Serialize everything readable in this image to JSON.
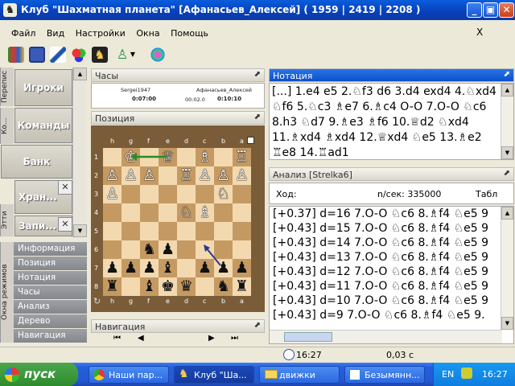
{
  "window": {
    "title": "Клуб \"Шахматная планета\" [Афанасьев_Алексей]  ( 1959 | 2419 | 2208 )"
  },
  "menu": [
    "Файл",
    "Вид",
    "Настройки",
    "Окна",
    "Помощь"
  ],
  "mdi_close": "X",
  "side": {
    "vtabs": [
      "Перепис",
      "Ко...",
      "Этти",
      "Окна режимов"
    ],
    "buttons": {
      "players": "Игроки",
      "teams": "Команды",
      "bank": "Банк",
      "storage": "Хран...",
      "records": "Запи..."
    },
    "nav_items": [
      "Информация",
      "Позиция",
      "Нотация",
      "Часы",
      "Анализ",
      "Дерево",
      "Навигация"
    ]
  },
  "panels": {
    "clocks": "Часы",
    "position": "Позиция",
    "notation": "Нотация",
    "analysis": "Анализ [Strelka6]",
    "navigation": "Навигация"
  },
  "clocks": {
    "white_name": "Sergei1947",
    "black_name": "Афанасьев_Алексей",
    "white_time": "0:07:00",
    "small_time": "00:02.0",
    "black_time": "0:10:10"
  },
  "board": {
    "files": [
      "h",
      "g",
      "f",
      "e",
      "d",
      "c",
      "b",
      "a"
    ],
    "ranks": [
      "1",
      "2",
      "3",
      "4",
      "5",
      "6",
      "7",
      "8"
    ],
    "pieces": [
      {
        "r": 0,
        "f": 1,
        "g": "♔",
        "c": "w"
      },
      {
        "r": 0,
        "f": 3,
        "g": "♕",
        "c": "w"
      },
      {
        "r": 0,
        "f": 5,
        "g": "♗",
        "c": "w"
      },
      {
        "r": 0,
        "f": 7,
        "g": "♖",
        "c": "w"
      },
      {
        "r": 1,
        "f": 0,
        "g": "♙",
        "c": "w"
      },
      {
        "r": 1,
        "f": 1,
        "g": "♙",
        "c": "w"
      },
      {
        "r": 1,
        "f": 2,
        "g": "♙",
        "c": "w"
      },
      {
        "r": 1,
        "f": 4,
        "g": "♖",
        "c": "w"
      },
      {
        "r": 1,
        "f": 5,
        "g": "♙",
        "c": "w"
      },
      {
        "r": 1,
        "f": 6,
        "g": "♙",
        "c": "w"
      },
      {
        "r": 1,
        "f": 7,
        "g": "♙",
        "c": "w"
      },
      {
        "r": 2,
        "f": 0,
        "g": "♙",
        "c": "w"
      },
      {
        "r": 2,
        "f": 6,
        "g": "♘",
        "c": "w"
      },
      {
        "r": 3,
        "f": 4,
        "g": "♘",
        "c": "w"
      },
      {
        "r": 3,
        "f": 5,
        "g": "♗",
        "c": "w"
      },
      {
        "r": 5,
        "f": 2,
        "g": "♞",
        "c": "b"
      },
      {
        "r": 5,
        "f": 3,
        "g": "♟",
        "c": "b"
      },
      {
        "r": 6,
        "f": 0,
        "g": "♟",
        "c": "b"
      },
      {
        "r": 6,
        "f": 1,
        "g": "♟",
        "c": "b"
      },
      {
        "r": 6,
        "f": 2,
        "g": "♟",
        "c": "b"
      },
      {
        "r": 6,
        "f": 3,
        "g": "♝",
        "c": "b"
      },
      {
        "r": 6,
        "f": 5,
        "g": "♟",
        "c": "b"
      },
      {
        "r": 6,
        "f": 6,
        "g": "♟",
        "c": "b"
      },
      {
        "r": 6,
        "f": 7,
        "g": "♟",
        "c": "b"
      },
      {
        "r": 7,
        "f": 0,
        "g": "♜",
        "c": "b"
      },
      {
        "r": 7,
        "f": 2,
        "g": "♝",
        "c": "b"
      },
      {
        "r": 7,
        "f": 4,
        "g": "♛",
        "c": "b"
      },
      {
        "r": 7,
        "f": 3,
        "g": "♚",
        "c": "b"
      },
      {
        "r": 7,
        "f": 6,
        "g": "♞",
        "c": "b"
      },
      {
        "r": 7,
        "f": 7,
        "g": "♜",
        "c": "b"
      }
    ]
  },
  "notation": "[...] 1.e4 e5 2.♘f3 d6 3.d4 exd4 4.♘xd4 ♘f6 5.♘c3 ♗e7 6.♗c4 O-O 7.O-O ♘c6 8.h3 ♘d7 9.♗e3 ♗f6 10.♕d2 ♘xd4 11.♗xd4 ♗xd4 12.♕xd4 ♘e5 13.♗e2 ♖e8 14.♖ad1",
  "analysis": {
    "move_label": "Ход:",
    "nps": "n/сек: 335000",
    "table_label": "Табл"
  },
  "lines": [
    "[+0.37] d=16 7.O-O ♘c6 8.♗f4 ♘e5 9",
    "[+0.43] d=15 7.O-O ♘c6 8.♗f4 ♘e5 9",
    "[+0.43] d=14 7.O-O ♘c6 8.♗f4 ♘e5 9",
    "[+0.43] d=13 7.O-O ♘c6 8.♗f4 ♘e5 9",
    "[+0.43] d=12 7.O-O ♘c6 8.♗f4 ♘e5 9",
    "[+0.43] d=11 7.O-O ♘c6 8.♗f4 ♘e5 9",
    "[+0.43] d=10 7.O-O ♘c6 8.♗f4 ♘e5 9",
    "[+0.43] d=9 7.O-O ♘c6 8.♗f4 ♘e5 9."
  ],
  "status": {
    "time": "16:27",
    "elapsed": "0,03 с"
  },
  "taskbar": {
    "start": "пуск",
    "tasks": [
      "Наши пар...",
      "Клуб \"Ша...",
      "движки",
      "Безымянн..."
    ],
    "lang": "EN",
    "clock": "16:27"
  },
  "colors": {
    "accent": "#0a4fc8",
    "board_light": "#f3d9b0",
    "board_dark": "#c59a62",
    "frame": "#7a5c38"
  }
}
